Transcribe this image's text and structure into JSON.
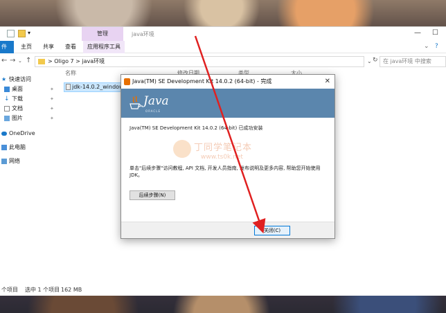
{
  "explorer": {
    "manage_tab": "管理",
    "window_name": "java环境",
    "ribbon": {
      "file": "件",
      "home": "主页",
      "share": "共享",
      "view": "查看",
      "app_tools": "应用程序工具"
    },
    "address": {
      "path_root": "Oligo 7",
      "sep": ">",
      "path_leaf": "java环境"
    },
    "search_placeholder": "在 java环境 中搜索",
    "nav": {
      "quick_access": "快速访问",
      "desktop": "桌面",
      "downloads": "下载",
      "documents": "文档",
      "pictures": "图片",
      "onedrive": "OneDrive",
      "this_pc": "此电脑",
      "network": "网络"
    },
    "columns": {
      "name": "名称",
      "modified": "修改日期",
      "type": "类型",
      "size": "大小"
    },
    "file_name": "jdk-14.0.2_windows-x64_bin.exe",
    "status": {
      "count": "个项目",
      "selected": "选中 1 个项目",
      "size": "162 MB"
    }
  },
  "dialog": {
    "title": "Java(TM) SE Development Kit 14.0.2 (64-bit) - 完成",
    "close_x": "✕",
    "logo_text": "Java",
    "oracle_text": "ORACLE",
    "message_installed": "Java(TM) SE Development Kit 14.0.2 (64-bit) 已成功安装",
    "message_next": "单击\"后续步骤\"访问教程, API 文档, 开发人员指南, 发布说明及更多内容, 帮助您开始使用 JDK。",
    "next_steps_button": "后续步骤(N)",
    "close_button": "关闭(C)"
  },
  "watermark": {
    "text": "丁同学笔记本",
    "url": "www.ts0k.net"
  },
  "colors": {
    "banner": "#5b86ad",
    "java_orange": "#e76f00",
    "arrow_red": "#e02020",
    "selection": "#cce8ff"
  }
}
